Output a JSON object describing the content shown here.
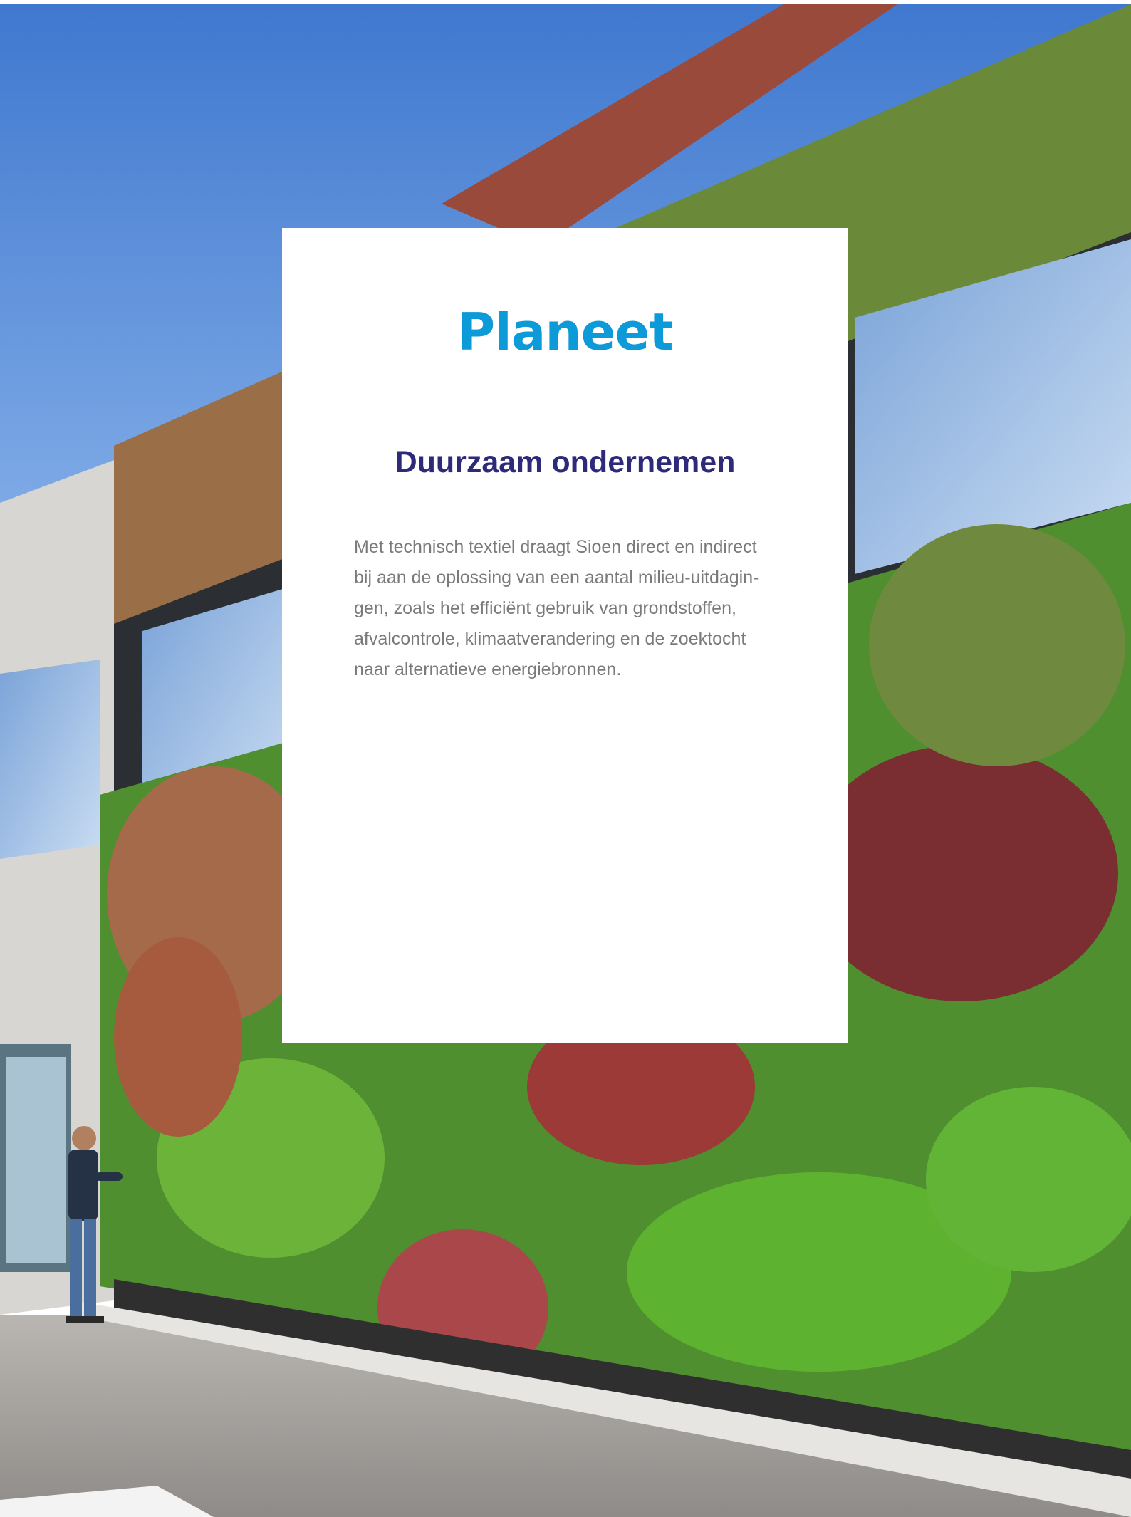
{
  "page": {
    "title": "Planeet",
    "subtitle": "Duurzaam ondernemen",
    "body_lines": [
      "Met technisch textiel draagt Sioen direct en indirect",
      "bij aan de oplossing van een aantal milieu-uitdagin-",
      "gen, zoals het efficiënt gebruik van grondstoffen,",
      "afvalcontrole, klimaatverandering en de zoektocht",
      "naar alternatieve energiebronnen."
    ]
  },
  "colors": {
    "title": "#0d9ad8",
    "subtitle": "#2e2a7a",
    "body": "#7a7a7a",
    "sky": "#4f86d6",
    "foliage": "#4f8f2f"
  },
  "background_photo": {
    "subject": "office building with green living wall and a man standing by the entrance"
  }
}
